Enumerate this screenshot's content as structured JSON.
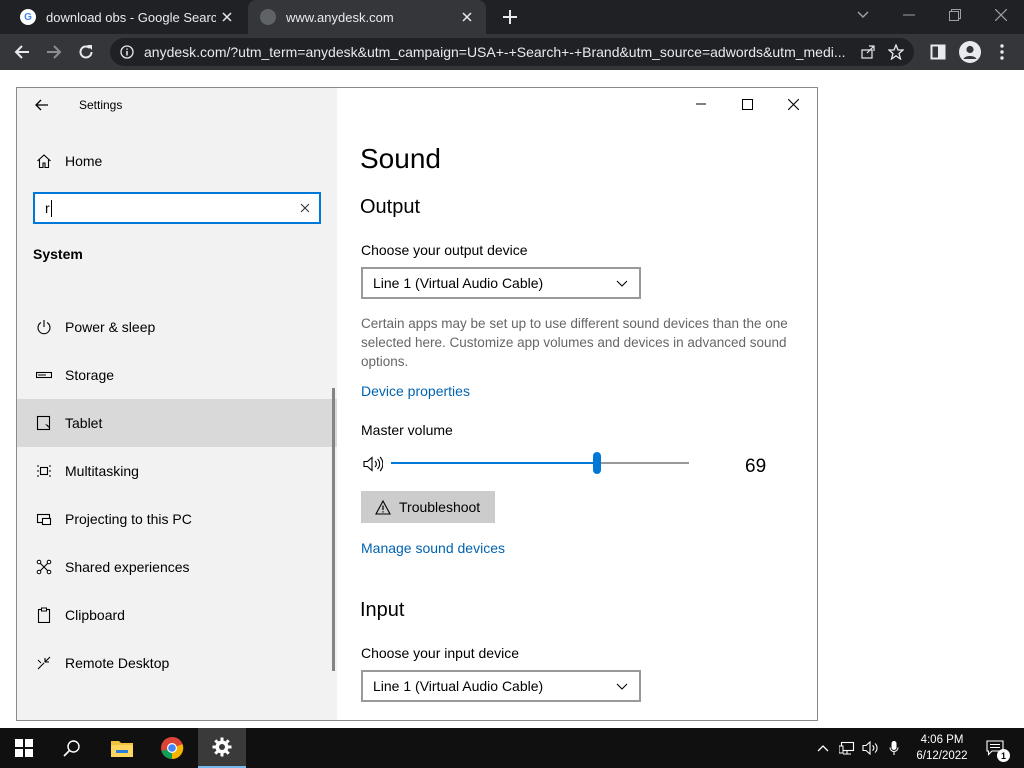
{
  "browser": {
    "tabs": [
      {
        "title": "download obs - Google Search",
        "favicon": "google-icon"
      },
      {
        "title": "www.anydesk.com",
        "favicon": "globe-icon"
      }
    ],
    "url": "anydesk.com/?utm_term=anydesk&utm_campaign=USA+-+Search+-+Brand&utm_source=adwords&utm_medi..."
  },
  "settings": {
    "window_title": "Settings",
    "sidebar": {
      "home_label": "Home",
      "search_value": "r",
      "section_header": "System",
      "items": [
        {
          "label": "Power & sleep",
          "icon": "power-icon"
        },
        {
          "label": "Storage",
          "icon": "storage-icon"
        },
        {
          "label": "Tablet",
          "icon": "tablet-icon",
          "selected": true
        },
        {
          "label": "Multitasking",
          "icon": "multitasking-icon"
        },
        {
          "label": "Projecting to this PC",
          "icon": "projecting-icon"
        },
        {
          "label": "Shared experiences",
          "icon": "shared-icon"
        },
        {
          "label": "Clipboard",
          "icon": "clipboard-icon"
        },
        {
          "label": "Remote Desktop",
          "icon": "remote-desktop-icon"
        }
      ]
    },
    "content": {
      "page_title": "Sound",
      "output": {
        "heading": "Output",
        "device_label": "Choose your output device",
        "device_value": "Line 1 (Virtual Audio Cable)",
        "description": "Certain apps may be set up to use different sound devices than the one selected here. Customize app volumes and devices in advanced sound options.",
        "device_properties_link": "Device properties",
        "master_volume_label": "Master volume",
        "volume_value": "69",
        "troubleshoot_label": "Troubleshoot",
        "manage_link": "Manage sound devices"
      },
      "input": {
        "heading": "Input",
        "device_label": "Choose your input device",
        "device_value": "Line 1 (Virtual Audio Cable)"
      }
    }
  },
  "taskbar": {
    "time": "4:06 PM",
    "date": "6/12/2022",
    "notification_count": "1"
  },
  "colors": {
    "accent": "#0078d7",
    "link": "#0063b1",
    "taskbar": "#101010",
    "chrome_dark": "#202124"
  }
}
